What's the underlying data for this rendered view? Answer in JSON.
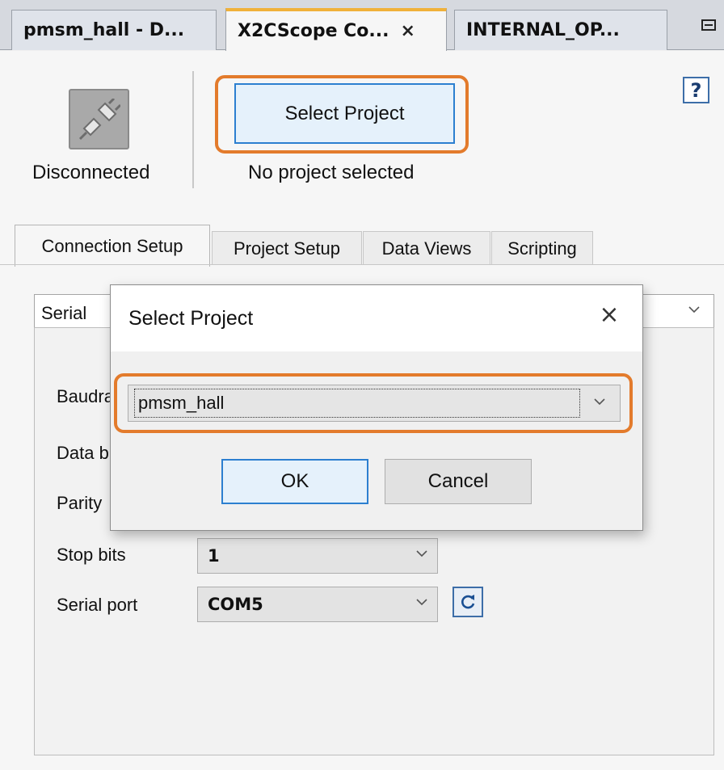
{
  "editor_tabs": [
    {
      "label": "pmsm_hall - D...",
      "active": false
    },
    {
      "label": "X2CScope Co...",
      "active": true,
      "close": "×"
    },
    {
      "label": "INTERNAL_OP...",
      "active": false
    }
  ],
  "toolbar": {
    "status_label": "Disconnected",
    "select_project_label": "Select Project",
    "project_status": "No project selected",
    "help_glyph": "?"
  },
  "tabs": [
    "Connection Setup",
    "Project Setup",
    "Data Views",
    "Scripting"
  ],
  "connection": {
    "type_value": "Serial",
    "fields": [
      {
        "label": "Baudrate"
      },
      {
        "label": "Data bits"
      },
      {
        "label": "Parity"
      },
      {
        "label": "Stop bits",
        "value": "1"
      },
      {
        "label": "Serial port",
        "value": "COM5"
      }
    ]
  },
  "dialog": {
    "title": "Select Project",
    "close_glyph": "×",
    "project_value": "pmsm_hall",
    "ok_label": "OK",
    "cancel_label": "Cancel"
  },
  "colors": {
    "highlight": "#e37b2c",
    "primary_border": "#2c7fd0",
    "active_tab_accent": "#f0b13a"
  }
}
